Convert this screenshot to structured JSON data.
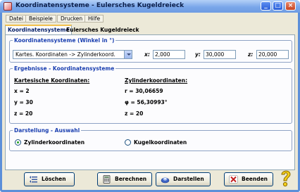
{
  "window": {
    "title": "Koordinatensysteme - Eulersches Kugeldreieck"
  },
  "titlebar_buttons": {
    "minimize": "_",
    "maximize": "□",
    "close": "×"
  },
  "menu": [
    "Datei",
    "Beispiele",
    "Drucken",
    "Hilfe"
  ],
  "tabs": [
    "Koordinatensysteme",
    "Eulersches Kugeldreieck"
  ],
  "coordsys": {
    "legend": "Koordinatensysteme (Winkel in °)",
    "selected": "Kartes. Koordinaten -> Zylinderkoord.",
    "x_label": "x:",
    "x_value": "2,000",
    "y_label": "y:",
    "y_value": "30,000",
    "z_label": "z:",
    "z_value": "20,000"
  },
  "results": {
    "legend": "Ergebnisse - Koordinatensysteme",
    "left_head": "Kartesische Koordinaten:",
    "left": [
      "x = 2",
      "y = 30",
      "z = 20"
    ],
    "right_head": "Zylinderkoordinaten:",
    "right": [
      "r = 30,06659",
      "φ = 56,30993°",
      "z = 20"
    ]
  },
  "display": {
    "legend": "Darstellung - Auswahl",
    "option1": "Zylinderkoordinaten",
    "option2": "Kugelkoordinaten",
    "selected": "Zylinderkoordinaten"
  },
  "buttons": {
    "loeschen": "Löschen",
    "berechnen": "Berechnen",
    "darstellen": "Darstellen",
    "beenden": "Beenden"
  },
  "icons": {
    "loeschen": "list-clear-icon",
    "berechnen": "calculator-icon",
    "darstellen": "chart-display-icon",
    "beenden": "exit-x-icon",
    "help": "help-question-icon"
  }
}
